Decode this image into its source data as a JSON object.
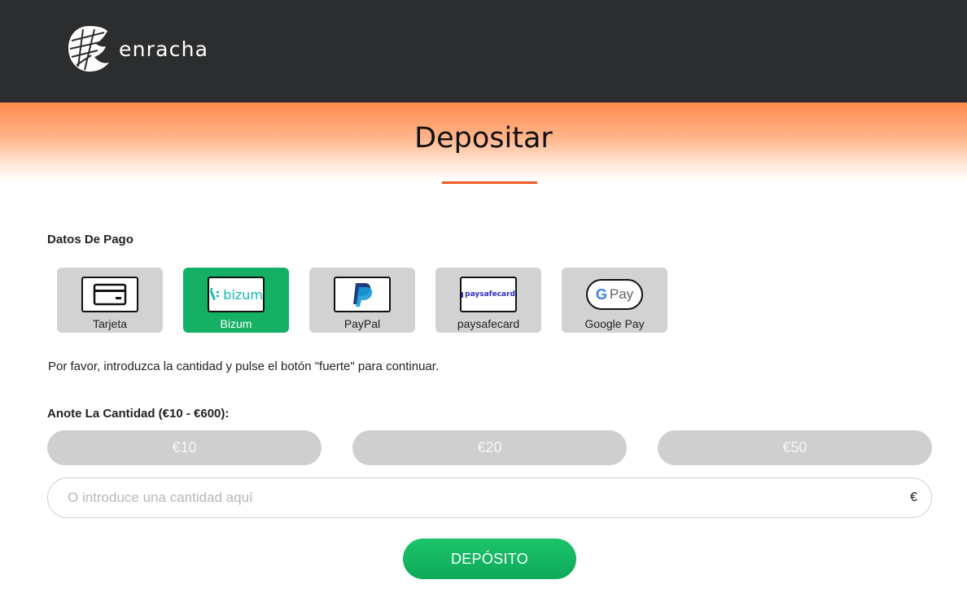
{
  "brand": {
    "name": "enracha"
  },
  "page": {
    "title": "Depositar"
  },
  "payment": {
    "section_label": "Datos De Pago",
    "selected": "Bizum",
    "methods": [
      {
        "label": "Tarjeta",
        "icon": "credit-card-icon"
      },
      {
        "label": "Bizum",
        "icon": "bizum-logo",
        "logo_text": "bizum"
      },
      {
        "label": "PayPal",
        "icon": "paypal-logo"
      },
      {
        "label": "paysafecard",
        "icon": "paysafecard-logo",
        "logo_text": "paysafecard"
      },
      {
        "label": "Google Pay",
        "icon": "google-pay-logo",
        "logo_text": "Pay"
      }
    ]
  },
  "instructions": "Por favor, introduzca la cantidad y pulse el botón \"fuerte\" para continuar.",
  "amount": {
    "label": "Anote La Cantidad (€10 - €600):",
    "quick": [
      "€10",
      "€20",
      "€50"
    ],
    "placeholder": "O introduce una cantidad aquí",
    "value": "",
    "currency": "€"
  },
  "deposit_button": "DEPÓSITO",
  "colors": {
    "header_bg": "#2b2d2e",
    "accent": "#f15a24",
    "selected_method": "#15b064",
    "deposit_button": "#15b064",
    "inactive_pill": "#cfcfcf"
  }
}
